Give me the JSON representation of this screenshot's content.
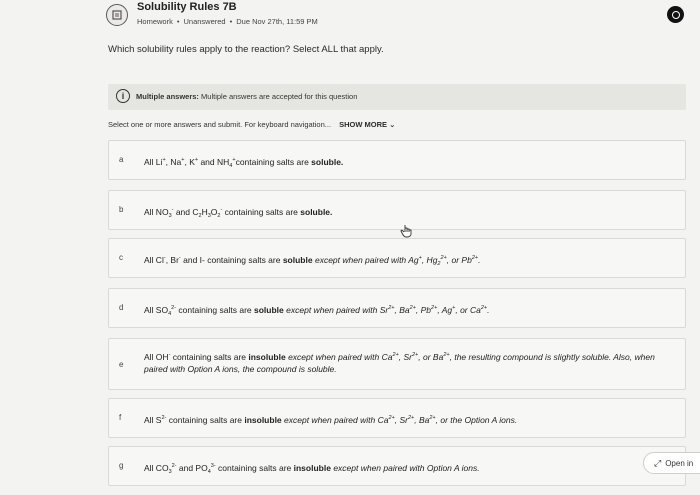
{
  "header": {
    "title": "Solubility Rules 7B",
    "type": "Homework",
    "status": "Unanswered",
    "due": "Due Nov 27th, 11:59 PM"
  },
  "question": "Which solubility rules apply to the reaction? Select ALL that apply.",
  "banner": {
    "label": "Multiple answers:",
    "text": "Multiple answers are accepted for this question"
  },
  "instructions": {
    "text": "Select one or more answers and submit. For keyboard navigation...",
    "show_more": "SHOW MORE"
  },
  "options": [
    {
      "letter": "a"
    },
    {
      "letter": "b"
    },
    {
      "letter": "c"
    },
    {
      "letter": "d"
    },
    {
      "letter": "e"
    },
    {
      "letter": "f"
    },
    {
      "letter": "g"
    }
  ],
  "open_button": "Open in"
}
